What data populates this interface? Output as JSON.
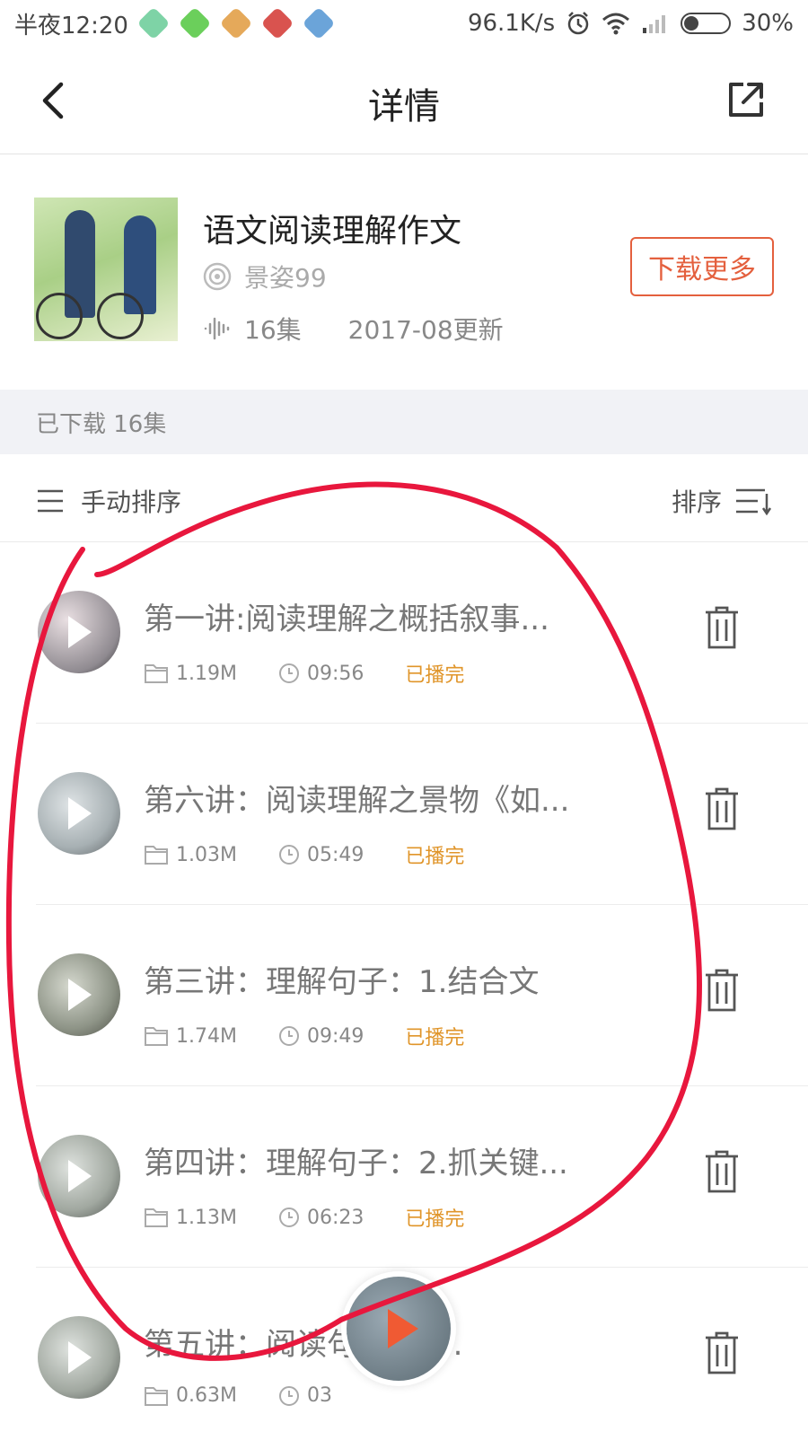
{
  "status_bar": {
    "time": "半夜12:20",
    "speed": "96.1K/s",
    "battery": "30%"
  },
  "nav": {
    "title": "详情"
  },
  "album": {
    "title": "语文阅读理解作文",
    "author": "景姿99",
    "episodes": "16集",
    "updated": "2017-08更新",
    "download_more": "下载更多"
  },
  "downloaded": {
    "label": "已下载 16集"
  },
  "sort": {
    "manual": "手动排序",
    "sort": "排序"
  },
  "episodes": [
    {
      "title": "第一讲:阅读理解之概括叙事...",
      "size": "1.19M",
      "duration": "09:56",
      "status": "已播完"
    },
    {
      "title": "第六讲：阅读理解之景物《如...",
      "size": "1.03M",
      "duration": "05:49",
      "status": "已播完"
    },
    {
      "title": "第三讲：理解句子：1.结合文",
      "size": "1.74M",
      "duration": "09:49",
      "status": "已播完"
    },
    {
      "title": "第四讲：理解句子：2.抓关键...",
      "size": "1.13M",
      "duration": "06:23",
      "status": "已播完"
    },
    {
      "title": "第五讲：阅读句子：《...",
      "size": "0.63M",
      "duration": "03",
      "status": ""
    }
  ],
  "colors": {
    "accent": "#e4603e",
    "played": "#e0952a",
    "annotation": "#e8173d"
  }
}
